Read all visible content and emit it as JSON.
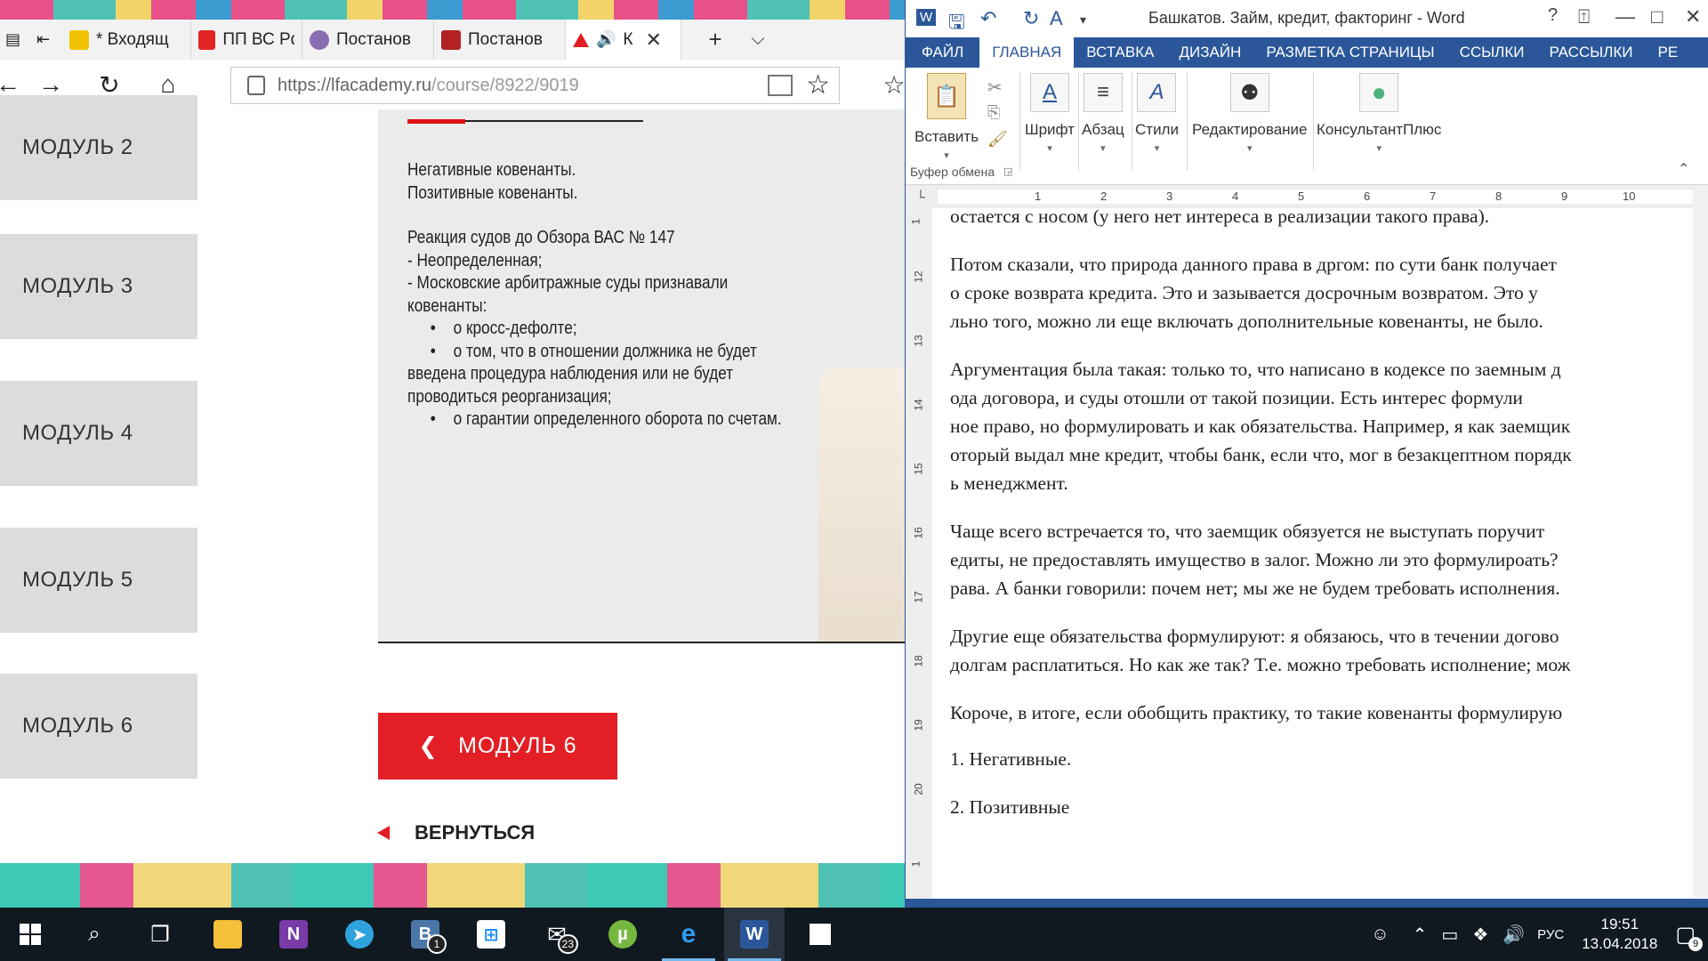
{
  "browser": {
    "tabs": [
      {
        "label": "* Входящ",
        "fav_color": "#f2c200"
      },
      {
        "label": "ПП ВС Рф",
        "fav_color": "#e02424"
      },
      {
        "label": "Постанов",
        "fav_color": "#8a6fb0"
      },
      {
        "label": "Постанов",
        "fav_color": "#b22222"
      },
      {
        "label": "К",
        "fav_color": "#e31e24"
      }
    ],
    "url_host": "https://lfacademy.ru",
    "url_path": "/course/8922/9019"
  },
  "course": {
    "modules": [
      "МОДУЛЬ 2",
      "МОДУЛЬ 3",
      "МОДУЛЬ 4",
      "МОДУЛЬ 5",
      "МОДУЛЬ 6"
    ],
    "slide_lines": {
      "l1": "Негативные ковенанты.",
      "l2": "Позитивные ковенанты.",
      "l3": "Реакция судов до Обзора ВАС № 147",
      "l4": "- Неопределенная;",
      "l5": "- Московские арбитражные суды признавали ковенанты:",
      "b1": "о кросс-дефолте;",
      "b2": "о том, что в отношении должника не будет",
      "l6": "введена процедура наблюдения или не будет",
      "l7": "проводиться реорганизация;",
      "b3": "о гарантии определенного оборота по счетам."
    },
    "prev_button": "МОДУЛЬ  6",
    "back_link": "ВЕРНУТЬСЯ"
  },
  "word": {
    "title": "Башкатов. Займ, кредит, факторинг - Word",
    "tabs": [
      "ФАЙЛ",
      "ГЛАВНАЯ",
      "ВСТАВКА",
      "ДИЗАЙН",
      "РАЗМЕТКА СТРАНИЦЫ",
      "ССЫЛКИ",
      "РАССЫЛКИ",
      "РЕ"
    ],
    "ribbon": {
      "paste": "Вставить",
      "font": "Шрифт",
      "paragraph": "Абзац",
      "styles": "Стили",
      "editing": "Редактирование",
      "consultant": "КонсультантПлюс",
      "clipboard_group": "Буфер обмена"
    },
    "ruler_numbers": [
      "1",
      "2",
      "3",
      "4",
      "5",
      "6",
      "7",
      "8",
      "9",
      "10"
    ],
    "vruler_numbers": [
      "1",
      "12",
      "13",
      "14",
      "15",
      "16",
      "17",
      "18",
      "19",
      "20",
      "1"
    ],
    "doc_lines": [
      "остается с носом (у него нет интереса в реализации такого права).",
      " Потом сказали, что природа данного права в дргом: по сути банк получает",
      "о сроке возврата кредита. Это и зазывается досрочным возвратом. Это у",
      "льно того, можно ли еще включать дополнительные ковенанты, не было.",
      " Аргументация была такая: только то, что написано в кодексе по заемным д",
      "ода договора, и суды отошли от такой позиции. Есть интерес формули",
      "ное право, но формулировать и как обязательства. Например, я как заемщик",
      "оторый выдал мне кредит, чтобы банк, если что, мог в безакцептном порядк",
      "ь менеджмент.",
      " Чаще всего встречается то, что заемщик обязуется не выступать поручит",
      "едиты, не предоставлять имущество в залог. Можно ли это формулироать?",
      "рава. А банки говорили: почем нет; мы же не будем требовать исполнения.",
      " Другие еще обязательства формулируют: я обязаюсь, что в течении догово",
      "долгам расплатиться. Но как же так? Т.е. можно требовать исполнение; мож",
      " Короче, в итоге, если обобщить практику, то такие ковенанты формулирую",
      " 1. Негативные.",
      " 2. Позитивные"
    ]
  },
  "taskbar": {
    "vk_badge": "1",
    "mail_badge": "23",
    "lang": "РУС",
    "time": "19:51",
    "date": "13.04.2018",
    "notif_count": "9"
  }
}
